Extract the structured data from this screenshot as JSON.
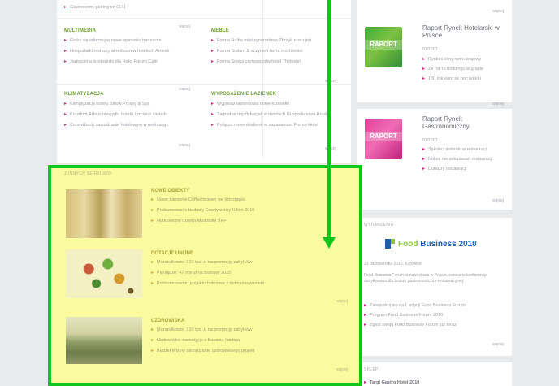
{
  "main": {
    "top_item": "Gastronomy pairing on CLH",
    "columns": [
      {
        "title": "MULTIMEDIA",
        "items": [
          "Gości się informuj w nowe spasaniu transacciu",
          "Hospodarki restaury akredlocm w hotelach Arriesk",
          "Jarmecima środowiski dla Hotel Forum Cafe"
        ],
        "more": "więcej"
      },
      {
        "title": "MEBLE",
        "items": [
          "Forma Halba międzynarodowa Zbrzyk szacujeń",
          "Forma Sudam & uczynień Asfra możliwości",
          "Forma Sneka czynowcódw hotel Thelostel"
        ],
        "more": "więcej"
      },
      {
        "title": "KLIMATYZACJA",
        "items": [
          "Klimatyzacja hotelu Stilow Pressy & Spa",
          "Konsfont Arbiuc niewydlu hotelu i zmiana zakładu",
          "Knowalbach zarządzanie hotelowym w nerlnisegs"
        ],
        "more": "więcej"
      },
      {
        "title": "WYPOSAŻENIE ŁAZIENEK",
        "items": [
          "Wyposaż łazienkowa nowe krzesełki",
          "Zagrodne najsflybacjali w hotelach Gospodarstwa Hotel",
          "Połączo nowe dealersk w zapasanium Forma Hotel"
        ],
        "more": "więcej"
      }
    ]
  },
  "right": {
    "reports": [
      {
        "title": "Raport Rynek Hotelarski w Polsce",
        "date": "01/2010",
        "cover_text": "RAPORT",
        "items": [
          "Rynkes silny netru krajowy",
          "Ze rok to hotelingu w grupie",
          "100 rok euro se hoc hotelu"
        ],
        "more": "więcej"
      },
      {
        "title": "Raport Rynek Gastronomiczny",
        "date": "01/2010",
        "cover_text": "RAPORT",
        "items": [
          "Spedeci autorski w restauracji",
          "Nolizę nie sekutowań restauracji",
          "Dunazry restauracji"
        ],
        "more": "więcej"
      }
    ],
    "events_header": "WYDARZENIA",
    "event": {
      "logo_main": "Food",
      "logo_accent": "Business 2010",
      "date_line": "21 października 2010, Katowice",
      "desc": "Food Business Forum to największa w Polsce, coroczna konferencja dedykowana dla branży gastronomiczno-restauracyjnej.",
      "items": [
        "Zarejestruj się na I. edycji Food Business Forum",
        "Program Food Business Forum 2010",
        "Zgłoś swoją Food Business Forum już teraz"
      ],
      "more": "więcej"
    },
    "bottom_header": "SKLEP",
    "bottom_item": "Targi Gastro Hotel 2010"
  },
  "highlight": {
    "section_label": "Z INNYCH SERWISÓW",
    "articles": [
      {
        "title": "NOWE OBIEKTY",
        "items": [
          "Nowe kamienie Coffeeheaven we Wrocławiu",
          "Podsumowanie budowy Courtyard by Hilton 2010",
          "Hotelowców rozwija Multihotel SPP"
        ],
        "more": "więcej"
      },
      {
        "title": "DOTACJE UNIJNE",
        "items": [
          "Marszałkowie: 310 tys. zł na promocję zabytków",
          "Pieniądze: 47 mln zł na budowę 2010",
          "Podsumowanie: projektu hotelowe z dofinansowaniem"
        ],
        "more": "więcej"
      },
      {
        "title": "UZDROWISKA",
        "items": [
          "Marszałkowie: 310 tys. zł na promocję zabytków",
          "Uzdrowisko: inwestycje z Busanią Istebna",
          "Budżet Wiślny zarządzanie uzdrowiskiego projekt"
        ],
        "more": "więcej"
      }
    ]
  }
}
